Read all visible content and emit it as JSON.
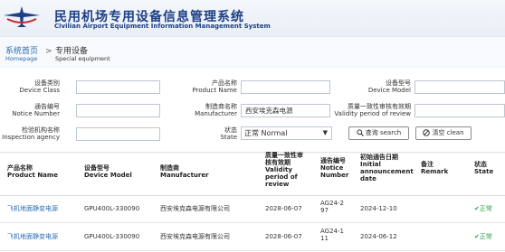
{
  "header": {
    "title_cn": "民用机场专用设备信息管理系统",
    "title_en": "Civilian Airport Equipment Information Management System"
  },
  "breadcrumb": {
    "home_cn": "系统首页",
    "home_en": "Homepage",
    "sep": ">",
    "current_cn": "专用设备",
    "current_en": "Special equipment"
  },
  "filters": {
    "device_class_cn": "设备类别",
    "device_class_en": "Device Class",
    "product_name_cn": "产品名称",
    "product_name_en": "Product Name",
    "device_model_cn": "设备型号",
    "device_model_en": "Device Model",
    "notice_number_cn": "通告编号",
    "notice_number_en": "Notice Number",
    "manufacturer_cn": "制造商名称",
    "manufacturer_en": "Manufacturer",
    "manufacturer_value": "西安埃克森电源",
    "validity_cn": "质量一致性审核有效期",
    "validity_en": "Validity period of review",
    "inspection_agency_cn": "检验机构名称",
    "inspection_agency_en": "Inspection agency",
    "state_cn": "状态",
    "state_en": "State",
    "state_value": "正常 Normal",
    "search_button": "查询 search",
    "clean_button": "清空 clean"
  },
  "table": {
    "headers": [
      {
        "cn": "产品名称",
        "en": "Product Name"
      },
      {
        "cn": "设备型号",
        "en": "Device Model"
      },
      {
        "cn": "制造商",
        "en": "Manufacturer"
      },
      {
        "cn": "质量一致性审核有效期",
        "en": "Validity period of review"
      },
      {
        "cn": "通告编号",
        "en": "Notice Number"
      },
      {
        "cn": "初始通告日期",
        "en": "Initial announcement date"
      },
      {
        "cn": "备注",
        "en": "Remark"
      },
      {
        "cn": "状态",
        "en": "State"
      }
    ],
    "rows": [
      {
        "product": "飞机地面静变电源",
        "model": "GPU400L-330090",
        "manufacturer": "西安埃克森电源有限公司",
        "validity": "2028-06-07",
        "notice": "AG24-297",
        "date": "2024-12-10",
        "remark": "",
        "state": "正常"
      },
      {
        "product": "飞机地面静变电源",
        "model": "GPU400L-330090",
        "manufacturer": "西安埃克森电源有限公司",
        "validity": "2028-06-07",
        "notice": "AG24-111",
        "date": "2024-06-12",
        "remark": "",
        "state": "正常"
      }
    ]
  },
  "colors": {
    "brand": "#1d3f84",
    "link": "#2b6cb3",
    "status": "#2ea14a"
  }
}
